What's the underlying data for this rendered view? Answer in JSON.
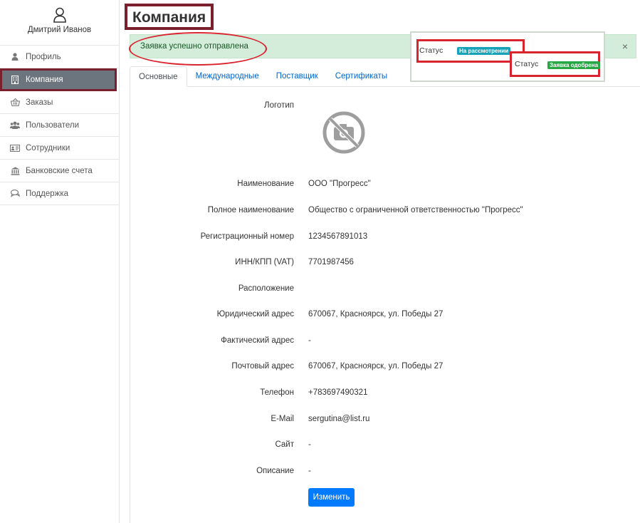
{
  "user": {
    "name": "Дмитрий Иванов",
    "icon": "user-icon"
  },
  "sidebar": {
    "items": [
      {
        "label": "Профиль",
        "icon": "user-icon"
      },
      {
        "label": "Компания",
        "icon": "building-icon",
        "active": true
      },
      {
        "label": "Заказы",
        "icon": "basket-icon"
      },
      {
        "label": "Пользователи",
        "icon": "users-icon"
      },
      {
        "label": "Сотрудники",
        "icon": "id-card-icon"
      },
      {
        "label": "Банковские счета",
        "icon": "bank-icon"
      },
      {
        "label": "Поддержка",
        "icon": "chat-icon"
      }
    ]
  },
  "page": {
    "title": "Компания"
  },
  "alert": {
    "text": "Заявка успешно отправлена",
    "close": "×"
  },
  "status": {
    "label": "Статус",
    "review_badge": "На рассмотрении",
    "approved_badge": "Заявка одобрена"
  },
  "tabs": [
    {
      "label": "Основные",
      "active": true
    },
    {
      "label": "Международные"
    },
    {
      "label": "Поставщик"
    },
    {
      "label": "Сертификаты"
    }
  ],
  "form": {
    "logo_label": "Логотип",
    "logo_icon": "no-camera-icon",
    "fields": [
      {
        "label": "Наименование",
        "value": "ООО \"Прогресс\""
      },
      {
        "label": "Полное наименование",
        "value": "Общество с ограниченной ответственностью \"Прогресс\""
      },
      {
        "label": "Регистрационный номер",
        "value": "1234567891013"
      },
      {
        "label": "ИНН/КПП (VAT)",
        "value": "7701987456"
      },
      {
        "label": "Расположение",
        "value": ""
      },
      {
        "label": "Юридический адрес",
        "value": "670067, Красноярск, ул. Победы 27"
      },
      {
        "label": "Фактический адрес",
        "value": "-"
      },
      {
        "label": "Почтовый адрес",
        "value": "670067, Красноярск, ул. Победы 27"
      },
      {
        "label": "Телефон",
        "value": "+783697490321"
      },
      {
        "label": "E-Mail",
        "value": "sergutina@list.ru"
      },
      {
        "label": "Сайт",
        "value": "-"
      },
      {
        "label": "Описание",
        "value": "-"
      }
    ],
    "edit_button": "Изменить"
  },
  "colors": {
    "highlight": "#7a1f2b",
    "annotation": "#d9232e",
    "alert_bg": "#d4edda",
    "primary": "#007bff",
    "active_nav": "#6c757d"
  }
}
